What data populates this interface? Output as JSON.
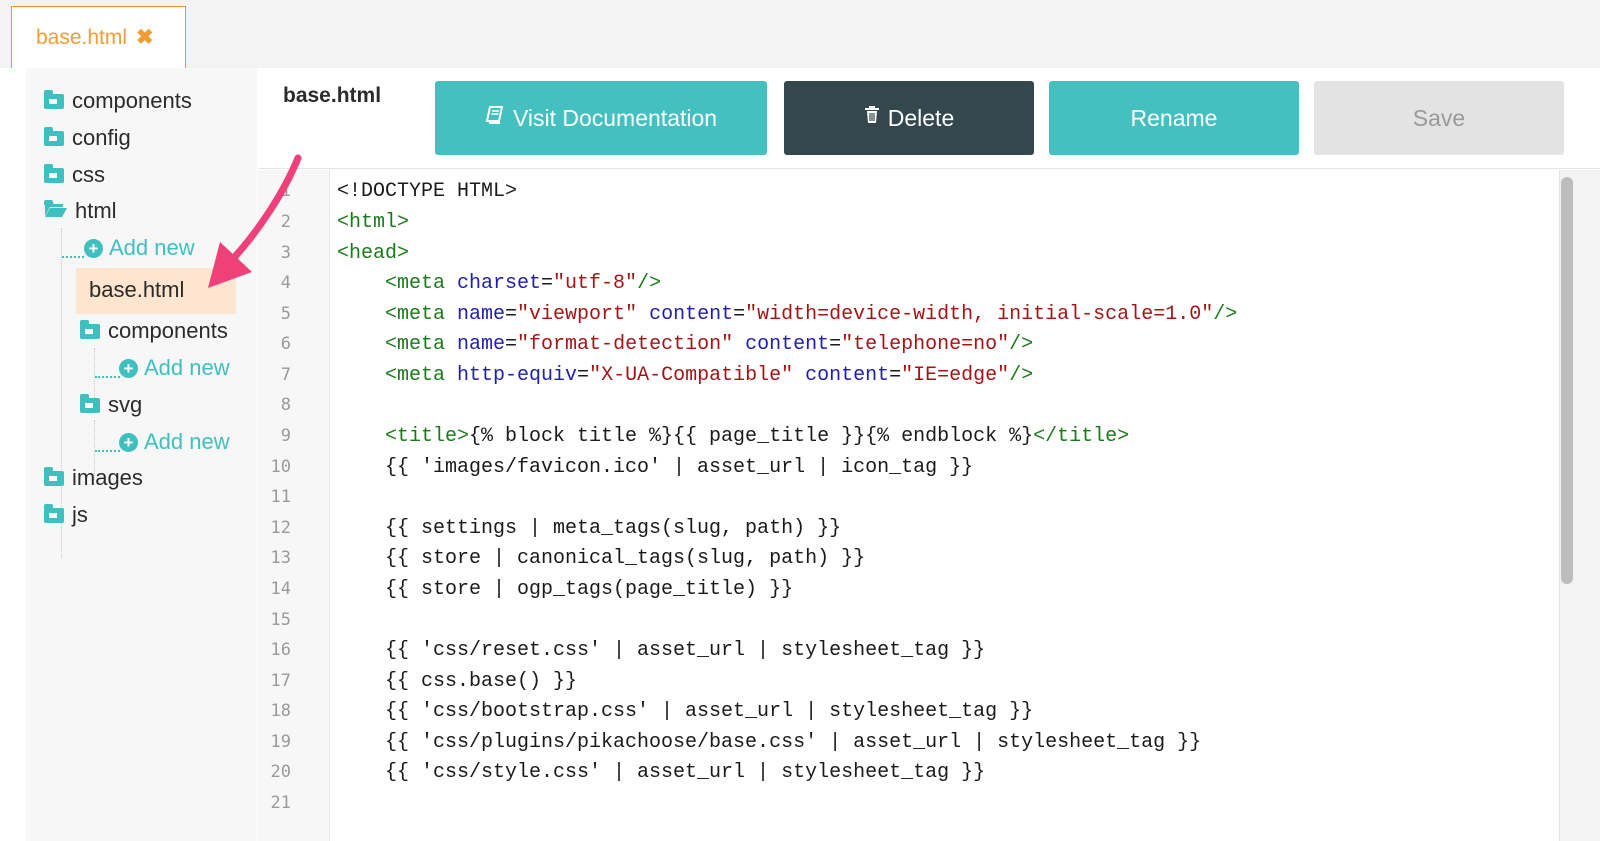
{
  "tab": {
    "label": "base.html",
    "close": "✖"
  },
  "sidebar": {
    "folders": [
      "components",
      "config",
      "css",
      "html",
      "images",
      "js"
    ],
    "html_children": {
      "add_new": "Add new",
      "file": "base.html",
      "components": "components",
      "components_add_new": "Add new",
      "svg": "svg",
      "svg_add_new": "Add new"
    }
  },
  "editor": {
    "filename": "base.html",
    "buttons": {
      "doc": "Visit Documentation",
      "delete": "Delete",
      "rename": "Rename",
      "save": "Save"
    }
  },
  "code": {
    "line_numbers": [
      "1",
      "2",
      "3",
      "4",
      "5",
      "6",
      "7",
      "8",
      "9",
      "10",
      "11",
      "12",
      "13",
      "14",
      "15",
      "16",
      "17",
      "18",
      "19",
      "20",
      "21"
    ],
    "l1": "<!DOCTYPE HTML>",
    "l2": "<html>",
    "l3": "<head>",
    "l4": [
      "<meta ",
      "charset",
      "=",
      "\"utf-8\"",
      "/>"
    ],
    "l5": [
      "<meta ",
      "name",
      "=",
      "\"viewport\"",
      " ",
      "content",
      "=",
      "\"width=device-width, initial-scale=1.0\"",
      "/>"
    ],
    "l6": [
      "<meta ",
      "name",
      "=",
      "\"format-detection\"",
      " ",
      "content",
      "=",
      "\"telephone=no\"",
      "/>"
    ],
    "l7": [
      "<meta ",
      "http-equiv",
      "=",
      "\"X-UA-Compatible\"",
      " ",
      "content",
      "=",
      "\"IE=edge\"",
      "/>"
    ],
    "l9": [
      "<title>",
      "{% block title %}{{ page_title }}{% endblock %}",
      "</title>"
    ],
    "l10": "{{ 'images/favicon.ico' | asset_url | icon_tag }}",
    "l12": "{{ settings | meta_tags(slug, path) }}",
    "l13": "{{ store | canonical_tags(slug, path) }}",
    "l14": "{{ store | ogp_tags(page_title) }}",
    "l16": "{{ 'css/reset.css' | asset_url | stylesheet_tag }}",
    "l17": "{{ css.base() }}",
    "l18": "{{ 'css/bootstrap.css' | asset_url | stylesheet_tag }}",
    "l19": "{{ 'css/plugins/pikachoose/base.css' | asset_url | stylesheet_tag }}",
    "l20": "{{ 'css/style.css' | asset_url | stylesheet_tag }}"
  },
  "colors": {
    "accent": "#45c0c0",
    "dark": "#33474c",
    "tab_orange": "#f39c34",
    "arrow": "#f0407a",
    "selected": "#fde5cf"
  }
}
